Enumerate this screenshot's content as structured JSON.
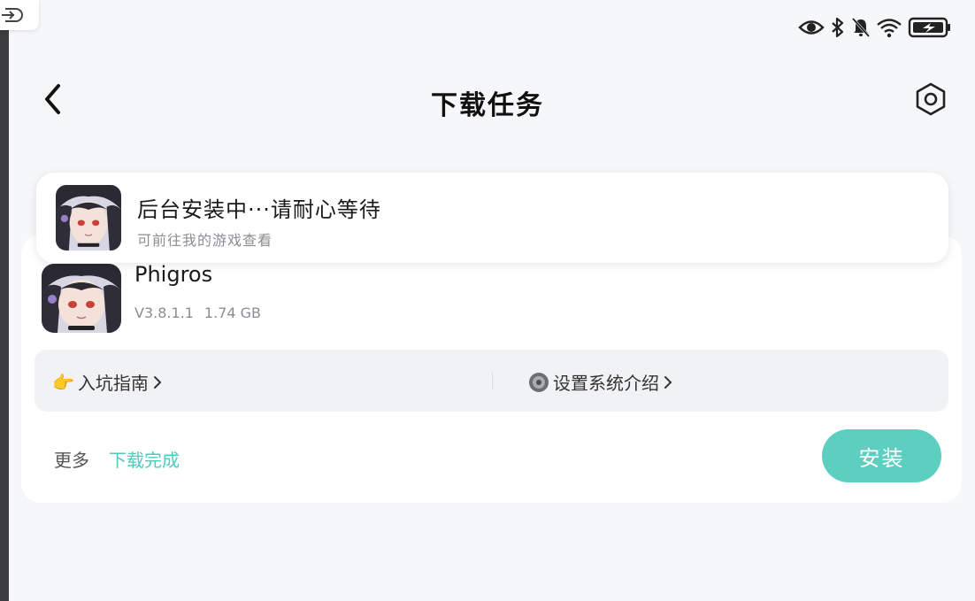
{
  "nav": {
    "title": "下载任务",
    "back_icon": "chevron-left-icon",
    "settings_icon": "hexagon-settings-icon"
  },
  "status_bar": {
    "icons": [
      "eye-icon",
      "bluetooth-icon",
      "bell-off-icon",
      "wifi-icon",
      "battery-charging-icon"
    ]
  },
  "toast": {
    "title": "后台安装中···请耐心等待",
    "subtitle": "可前往我的游戏查看"
  },
  "task": {
    "app_name": "Phigros",
    "version": "V3.8.1.1",
    "size": "1.74 GB",
    "links": [
      {
        "emoji": "👉",
        "label": "入坑指南"
      },
      {
        "icon": "gear-badge-icon",
        "label": "设置系统介绍"
      }
    ],
    "more_label": "更多",
    "status": "下载完成",
    "install_label": "安装"
  },
  "colors": {
    "accent": "#5dcfc0",
    "accent_text": "#4ecbbd",
    "background": "#f6f7f9",
    "card": "#ffffff"
  }
}
